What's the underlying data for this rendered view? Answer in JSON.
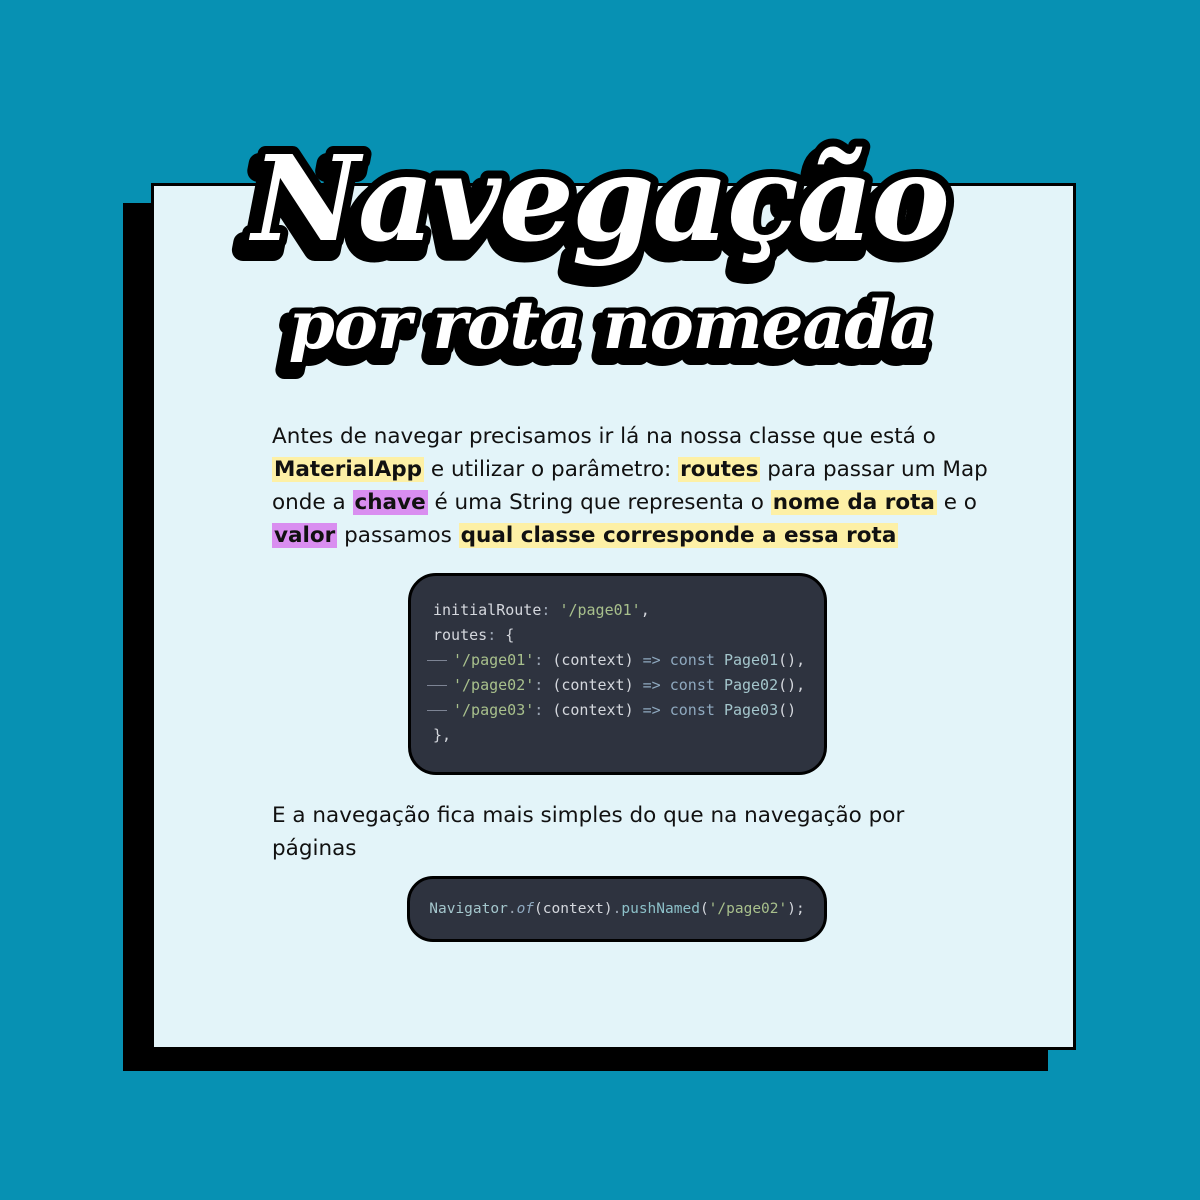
{
  "title": {
    "main": "Navegação",
    "sub": "por rota nomeada"
  },
  "intro": {
    "t1": "Antes de navegar precisamos ir lá na nossa classe que está o ",
    "h1": "MaterialApp",
    "t2": " e utilizar o parâmetro: ",
    "h2": "routes",
    "t3": " para passar um Map onde a ",
    "h3": "chave",
    "t4": " é uma String que representa o ",
    "h4": "nome da rota",
    "t5": " e o ",
    "h5": "valor",
    "t6": " passamos ",
    "h6": "qual classe corresponde a essa rota"
  },
  "code_routes": {
    "l1": {
      "prop": "initialRoute",
      "p1": ": ",
      "str": "'/page01'",
      "p2": ","
    },
    "l2": {
      "prop": "routes",
      "p1": ": ",
      "p2": "{"
    },
    "l3": {
      "str": "'/page01'",
      "p1": ": ",
      "args": "(context) ",
      "arrow": "=>",
      "kw": " const ",
      "cls": "Page01",
      "end": "(),"
    },
    "l4": {
      "str": "'/page02'",
      "p1": ": ",
      "args": "(context) ",
      "arrow": "=>",
      "kw": " const ",
      "cls": "Page02",
      "end": "(),"
    },
    "l5": {
      "str": "'/page03'",
      "p1": ": ",
      "args": "(context) ",
      "arrow": "=>",
      "kw": " const ",
      "cls": "Page03",
      "end": "()"
    },
    "l6": {
      "p1": "},"
    }
  },
  "outro": "E a navegação fica mais simples do que na navegação por páginas",
  "code_nav": {
    "cls": "Navigator",
    "dot1": ".",
    "of": "of",
    "args": "(context)",
    "dot2": ".",
    "fn": "pushNamed",
    "open": "(",
    "str": "'/page02'",
    "close": ");"
  },
  "colors": {
    "background": "#0791b3",
    "card": "#e3f4f9",
    "highlight_yellow": "#fdf0a6",
    "highlight_purple": "#d98ef0",
    "code_bg": "#2e333f"
  }
}
